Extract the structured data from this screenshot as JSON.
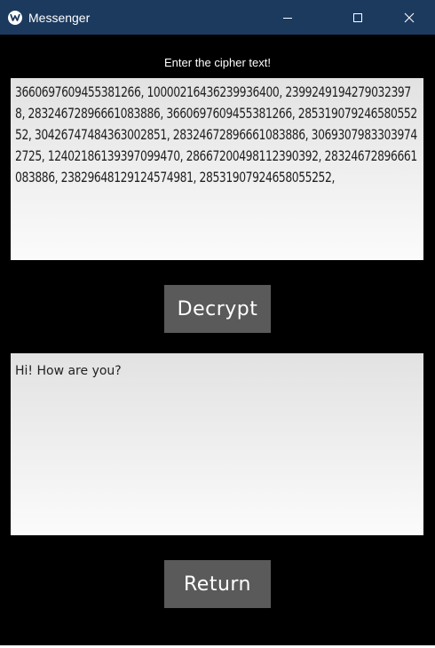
{
  "window": {
    "title": "Messenger",
    "accent": "#1c3a5e"
  },
  "cipher": {
    "prompt": "Enter the cipher text!",
    "value": "3660697609455381266, 10000216436239936400, 23992491942790323978, 28324672896661083886, 3660697609455381266, 28531907924658055252, 30426747484363002851, 28324672896661083886, 30693079833039742725, 12402186139397099470, 28667200498112390392, 28324672896661083886, 23829648129124574981, 28531907924658055252,"
  },
  "decrypt_button": {
    "label": "Decrypt"
  },
  "plain": {
    "value": "Hi! How are you?"
  },
  "return_button": {
    "label": "Return"
  },
  "icons": [
    "app-icon",
    "minimize-icon",
    "maximize-icon",
    "close-icon"
  ]
}
